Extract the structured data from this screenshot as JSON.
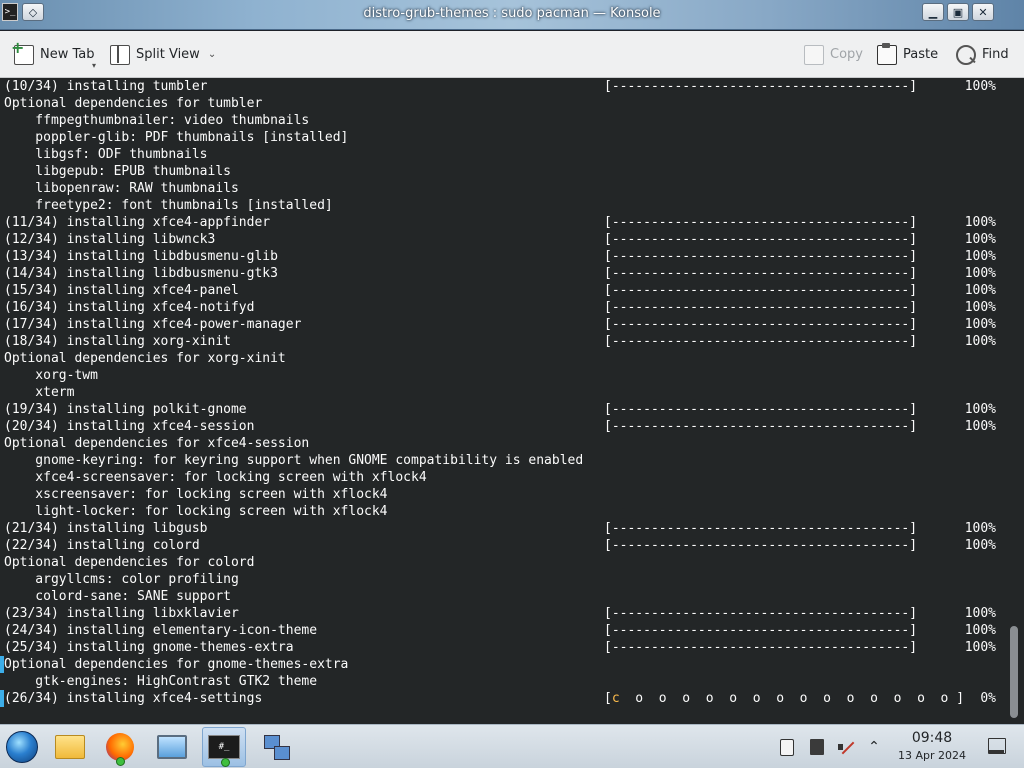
{
  "window": {
    "title": "distro-grub-themes : sudo pacman — Konsole",
    "app_icon_text": ">_",
    "min_glyph": "▁",
    "max_glyph": "▣",
    "close_glyph": "✕"
  },
  "toolbar": {
    "new_tab_label": "New Tab",
    "split_view_label": "Split View",
    "copy_label": "Copy",
    "paste_label": "Paste",
    "find_label": "Find"
  },
  "terminal": {
    "lines": [
      {
        "text": "(10/34) installing tumbler",
        "bar": "[--------------------------------------]",
        "pct": "100%"
      },
      {
        "text": "Optional dependencies for tumbler"
      },
      {
        "text": "    ffmpegthumbnailer: video thumbnails"
      },
      {
        "text": "    poppler-glib: PDF thumbnails [installed]"
      },
      {
        "text": "    libgsf: ODF thumbnails"
      },
      {
        "text": "    libgepub: EPUB thumbnails"
      },
      {
        "text": "    libopenraw: RAW thumbnails"
      },
      {
        "text": "    freetype2: font thumbnails [installed]"
      },
      {
        "text": "(11/34) installing xfce4-appfinder",
        "bar": "[--------------------------------------]",
        "pct": "100%"
      },
      {
        "text": "(12/34) installing libwnck3",
        "bar": "[--------------------------------------]",
        "pct": "100%"
      },
      {
        "text": "(13/34) installing libdbusmenu-glib",
        "bar": "[--------------------------------------]",
        "pct": "100%"
      },
      {
        "text": "(14/34) installing libdbusmenu-gtk3",
        "bar": "[--------------------------------------]",
        "pct": "100%"
      },
      {
        "text": "(15/34) installing xfce4-panel",
        "bar": "[--------------------------------------]",
        "pct": "100%"
      },
      {
        "text": "(16/34) installing xfce4-notifyd",
        "bar": "[--------------------------------------]",
        "pct": "100%"
      },
      {
        "text": "(17/34) installing xfce4-power-manager",
        "bar": "[--------------------------------------]",
        "pct": "100%"
      },
      {
        "text": "(18/34) installing xorg-xinit",
        "bar": "[--------------------------------------]",
        "pct": "100%"
      },
      {
        "text": "Optional dependencies for xorg-xinit"
      },
      {
        "text": "    xorg-twm"
      },
      {
        "text": "    xterm"
      },
      {
        "text": "(19/34) installing polkit-gnome",
        "bar": "[--------------------------------------]",
        "pct": "100%"
      },
      {
        "text": "(20/34) installing xfce4-session",
        "bar": "[--------------------------------------]",
        "pct": "100%"
      },
      {
        "text": "Optional dependencies for xfce4-session"
      },
      {
        "text": "    gnome-keyring: for keyring support when GNOME compatibility is enabled"
      },
      {
        "text": "    xfce4-screensaver: for locking screen with xflock4"
      },
      {
        "text": "    xscreensaver: for locking screen with xflock4"
      },
      {
        "text": "    light-locker: for locking screen with xflock4"
      },
      {
        "text": "(21/34) installing libgusb",
        "bar": "[--------------------------------------]",
        "pct": "100%"
      },
      {
        "text": "(22/34) installing colord",
        "bar": "[--------------------------------------]",
        "pct": "100%"
      },
      {
        "text": "Optional dependencies for colord"
      },
      {
        "text": "    argyllcms: color profiling"
      },
      {
        "text": "    colord-sane: SANE support"
      },
      {
        "text": "(23/34) installing libxklavier",
        "bar": "[--------------------------------------]",
        "pct": "100%"
      },
      {
        "text": "(24/34) installing elementary-icon-theme",
        "bar": "[--------------------------------------]",
        "pct": "100%"
      },
      {
        "text": "(25/34) installing gnome-themes-extra",
        "bar": "[--------------------------------------]",
        "pct": "100%"
      },
      {
        "text": "Optional dependencies for gnome-themes-extra"
      },
      {
        "text": "    gtk-engines: HighContrast GTK2 theme"
      },
      {
        "text": "(26/34) installing xfce4-settings",
        "bar_open": "[",
        "bar_pac": "c",
        "bar_rest": "  o  o  o  o  o  o  o  o  o  o  o  o  o  o ]",
        "pct": "0%"
      }
    ]
  },
  "taskbar": {
    "konsole_icon_text": "#_",
    "tray_chevron": "⌃",
    "clock_time": "09:48",
    "clock_date": "13 Apr 2024"
  },
  "colors": {
    "terminal_bg": "#232627",
    "terminal_fg": "#fcfcfc",
    "accent": "#3daee9",
    "pacman": "#fdbc4b"
  }
}
